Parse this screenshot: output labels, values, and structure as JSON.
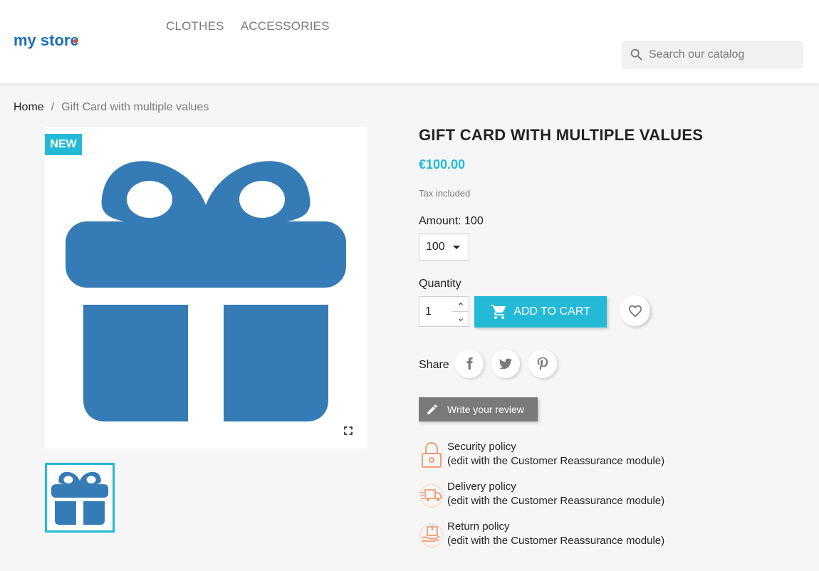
{
  "header": {
    "logo_text": "my store",
    "nav": [
      "CLOTHES",
      "ACCESSORIES"
    ],
    "search_placeholder": "Search our catalog"
  },
  "breadcrumb": {
    "home": "Home",
    "separator": "/",
    "current": "Gift Card with multiple values"
  },
  "product": {
    "badge": "NEW",
    "title": "GIFT CARD WITH MULTIPLE VALUES",
    "price": "€100.00",
    "tax_note": "Tax included",
    "amount_label": "Amount: 100",
    "amount_selected": "100",
    "quantity_label": "Quantity",
    "quantity_value": "1",
    "add_to_cart": "ADD TO CART",
    "share_label": "Share",
    "review_button": "Write your review"
  },
  "reassurance": [
    {
      "title": "Security policy",
      "detail": "(edit with the Customer Reassurance module)"
    },
    {
      "title": "Delivery policy",
      "detail": "(edit with the Customer Reassurance module)"
    },
    {
      "title": "Return policy",
      "detail": "(edit with the Customer Reassurance module)"
    }
  ],
  "colors": {
    "accent": "#24b9d7",
    "gift": "#357bb5",
    "reassure_icon": "#f19d76"
  }
}
